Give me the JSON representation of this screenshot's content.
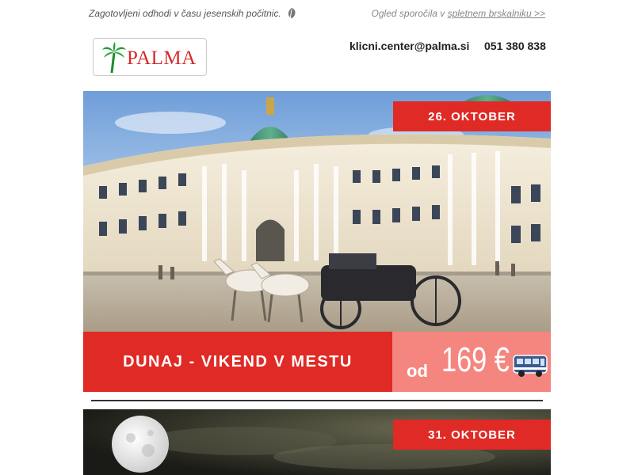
{
  "header": {
    "tagline": "Zagotovljeni odhodi v času jesenskih počitnic.",
    "webview_prefix": "Ogled sporočila v ",
    "webview_link": "spletnem brskalniku >>"
  },
  "logo": {
    "text": "PALMA"
  },
  "contact": {
    "email": "klicni.center@palma.si",
    "phone": "051 380 838"
  },
  "offers": [
    {
      "date": "26. OKTOBER",
      "title": "DUNAJ - VIKEND V MESTU",
      "price_prefix": "od",
      "price": "169 €",
      "transport_icon": "bus-icon"
    },
    {
      "date": "31. OKTOBER"
    }
  ],
  "colors": {
    "accent_red": "#e02a25",
    "price_pink": "#f4867f",
    "logo_red": "#d62a2a"
  }
}
